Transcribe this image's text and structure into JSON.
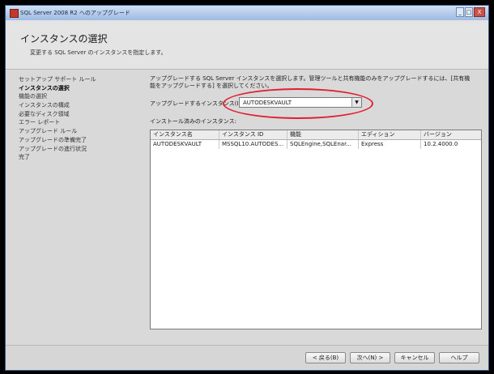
{
  "window": {
    "title": "SQL Server 2008 R2 へのアップグレード",
    "minimize": "_",
    "maximize": "□",
    "close": "X"
  },
  "header": {
    "title": "インスタンスの選択",
    "subtitle": "変更する SQL Server のインスタンスを指定します。"
  },
  "sidebar": {
    "items": [
      {
        "label": "セットアップ サポート ルール",
        "active": false
      },
      {
        "label": "インスタンスの選択",
        "active": true
      },
      {
        "label": "機能の選択",
        "active": false
      },
      {
        "label": "インスタンスの構成",
        "active": false
      },
      {
        "label": "必要なディスク領域",
        "active": false
      },
      {
        "label": "エラー レポート",
        "active": false
      },
      {
        "label": "アップグレード ルール",
        "active": false
      },
      {
        "label": "アップグレードの準備完了",
        "active": false
      },
      {
        "label": "アップグレードの進行状況",
        "active": false
      },
      {
        "label": "完了",
        "active": false
      }
    ]
  },
  "main": {
    "description": "アップグレードする SQL Server インスタンスを選択します。管理ツールと共有機能のみをアップグレードするには、[共有機能をアップグレードする] を選択してください。",
    "instance_label": "アップグレードするインスタンス(I):",
    "instance_value": "AUTODESKVAULT",
    "dropdown_arrow": "▼",
    "installed_label": "インストール済みのインスタンス:",
    "table": {
      "headers": [
        "インスタンス名",
        "インスタンス ID",
        "機能",
        "エディション",
        "バージョン"
      ],
      "rows": [
        [
          "AUTODESKVAULT",
          "MSSQL10.AUTODES...",
          "SQLEngine,SQLEnar...",
          "Express",
          "10.2.4000.0"
        ]
      ]
    }
  },
  "footer": {
    "back": "< 戻る(B)",
    "next": "次へ(N) >",
    "cancel": "キャンセル",
    "help": "ヘルプ"
  },
  "colors": {
    "highlight": "#e02030",
    "titlebar": "#9ebbe2"
  }
}
